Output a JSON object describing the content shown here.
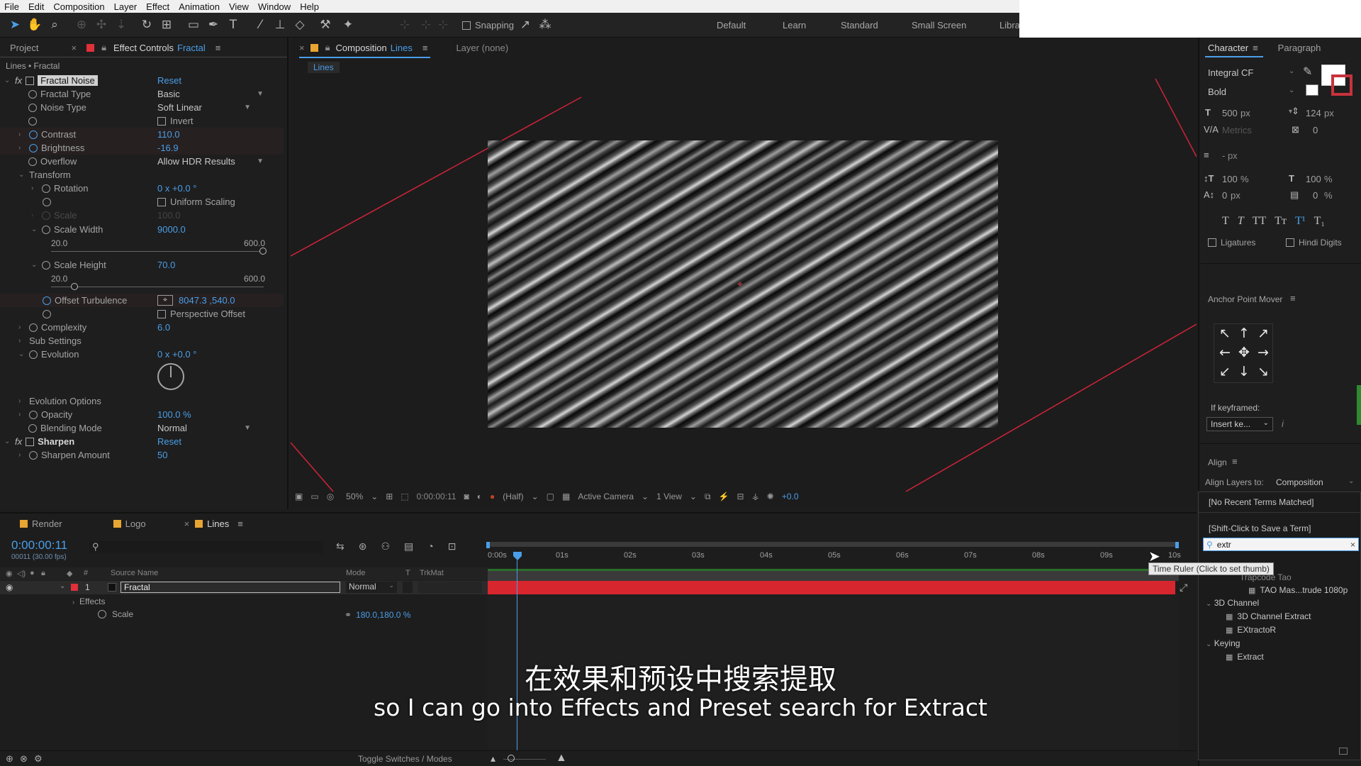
{
  "menu": [
    "File",
    "Edit",
    "Composition",
    "Layer",
    "Effect",
    "Animation",
    "View",
    "Window",
    "Help"
  ],
  "toolbar": {
    "snapping_label": "Snapping",
    "workspaces": [
      "Default",
      "Learn",
      "Standard",
      "Small Screen",
      "Libra"
    ]
  },
  "effect_controls": {
    "project_tab": "Project",
    "tab_prefix": "Effect Controls",
    "tab_layer": "Fractal",
    "breadcrumb": "Lines • Fractal",
    "fractal_noise": {
      "name": "Fractal Noise",
      "reset": "Reset",
      "fractal_type_label": "Fractal Type",
      "fractal_type_value": "Basic",
      "noise_type_label": "Noise Type",
      "noise_type_value": "Soft Linear",
      "invert_label": "Invert",
      "contrast_label": "Contrast",
      "contrast_value": "110.0",
      "brightness_label": "Brightness",
      "brightness_value": "-16.9",
      "overflow_label": "Overflow",
      "overflow_value": "Allow HDR Results",
      "transform_label": "Transform",
      "rotation_label": "Rotation",
      "rotation_value": "0 x +0.0 °",
      "uniform_scaling_label": "Uniform Scaling",
      "scale_label": "Scale",
      "scale_value": "100.0",
      "scale_width_label": "Scale Width",
      "scale_width_value": "9000.0",
      "scale_width_min": "20.0",
      "scale_width_max": "600.0",
      "scale_height_label": "Scale Height",
      "scale_height_value": "70.0",
      "scale_height_min": "20.0",
      "scale_height_max": "600.0",
      "offset_turbulence_label": "Offset Turbulence",
      "offset_turbulence_value": "8047.3 ,540.0",
      "perspective_offset_label": "Perspective Offset",
      "complexity_label": "Complexity",
      "complexity_value": "6.0",
      "sub_settings_label": "Sub Settings",
      "evolution_label": "Evolution",
      "evolution_value": "0 x +0.0 °",
      "evolution_options_label": "Evolution Options",
      "opacity_label": "Opacity",
      "opacity_value": "100.0 %",
      "blending_mode_label": "Blending Mode",
      "blending_mode_value": "Normal"
    },
    "sharpen": {
      "name": "Sharpen",
      "reset": "Reset",
      "amount_label": "Sharpen Amount",
      "amount_value": "50"
    }
  },
  "composition": {
    "tab_prefix": "Composition",
    "tab_name": "Lines",
    "layer_label": "Layer (none)",
    "breadcrumb": "Lines",
    "zoom": "50%",
    "timecode": "0:00:00:11",
    "resolution": "(Half)",
    "camera": "Active Camera",
    "views": "1 View",
    "exposure": "+0.0"
  },
  "character": {
    "tab": "Character",
    "tab2": "Paragraph",
    "font": "Integral CF",
    "style": "Bold",
    "size": "500",
    "size_unit": "px",
    "leading": "124",
    "leading_unit": "px",
    "kerning": "Metrics",
    "tracking": "0",
    "stroke": "- px",
    "vscale": "100",
    "hscale": "100",
    "pct": "%",
    "baseline": "0",
    "baseline_unit": "px",
    "tsume": "0",
    "text_styles": [
      "T",
      "T",
      "TT",
      "Tт",
      "T¹",
      "T₁"
    ],
    "ligatures": "Ligatures",
    "hindi_digits": "Hindi Digits"
  },
  "anchor_point_mover": {
    "title": "Anchor Point Mover",
    "if_keyframed": "If keyframed:",
    "insert_value": "Insert ke..."
  },
  "align": {
    "title": "Align",
    "align_to_label": "Align Layers to:",
    "align_to_value": "Composition"
  },
  "effects_presets": {
    "no_recent": "[No Recent Terms Matched]",
    "shift_click": "[Shift-Click to Save a Term]",
    "search_value": "extr",
    "items": [
      {
        "type": "item",
        "label": "Trapcode Tao"
      },
      {
        "type": "item",
        "label": "TAO Mas...trude 1080p"
      },
      {
        "type": "category",
        "label": "3D Channel"
      },
      {
        "type": "item",
        "label": "3D Channel Extract"
      },
      {
        "type": "item",
        "label": "EXtractoR"
      },
      {
        "type": "category",
        "label": "Keying"
      },
      {
        "type": "item",
        "label": "Extract"
      }
    ],
    "tooltip": "Time Ruler (Click to set thumb)"
  },
  "timeline": {
    "tabs": [
      "Render",
      "Logo",
      "Lines"
    ],
    "timecode": "0:00:00:11",
    "frame_info": "00011 (30.00 fps)",
    "col_source": "Source Name",
    "col_mode": "Mode",
    "col_t": "T",
    "col_trkmat": "TrkMat",
    "layer_index": "1",
    "layer_name": "Fractal",
    "layer_mode": "Normal",
    "effects_label": "Effects",
    "scale_label": "Scale",
    "scale_value": "180.0,180.0 %",
    "ticks": [
      "0:00s",
      "01s",
      "02s",
      "03s",
      "04s",
      "05s",
      "06s",
      "07s",
      "08s",
      "09s",
      "10s"
    ],
    "toggle_label": "Toggle Switches / Modes"
  },
  "subtitles": {
    "zh": "在效果和预设中搜索提取",
    "en": "so I can go into Effects and Preset search for Extract"
  }
}
